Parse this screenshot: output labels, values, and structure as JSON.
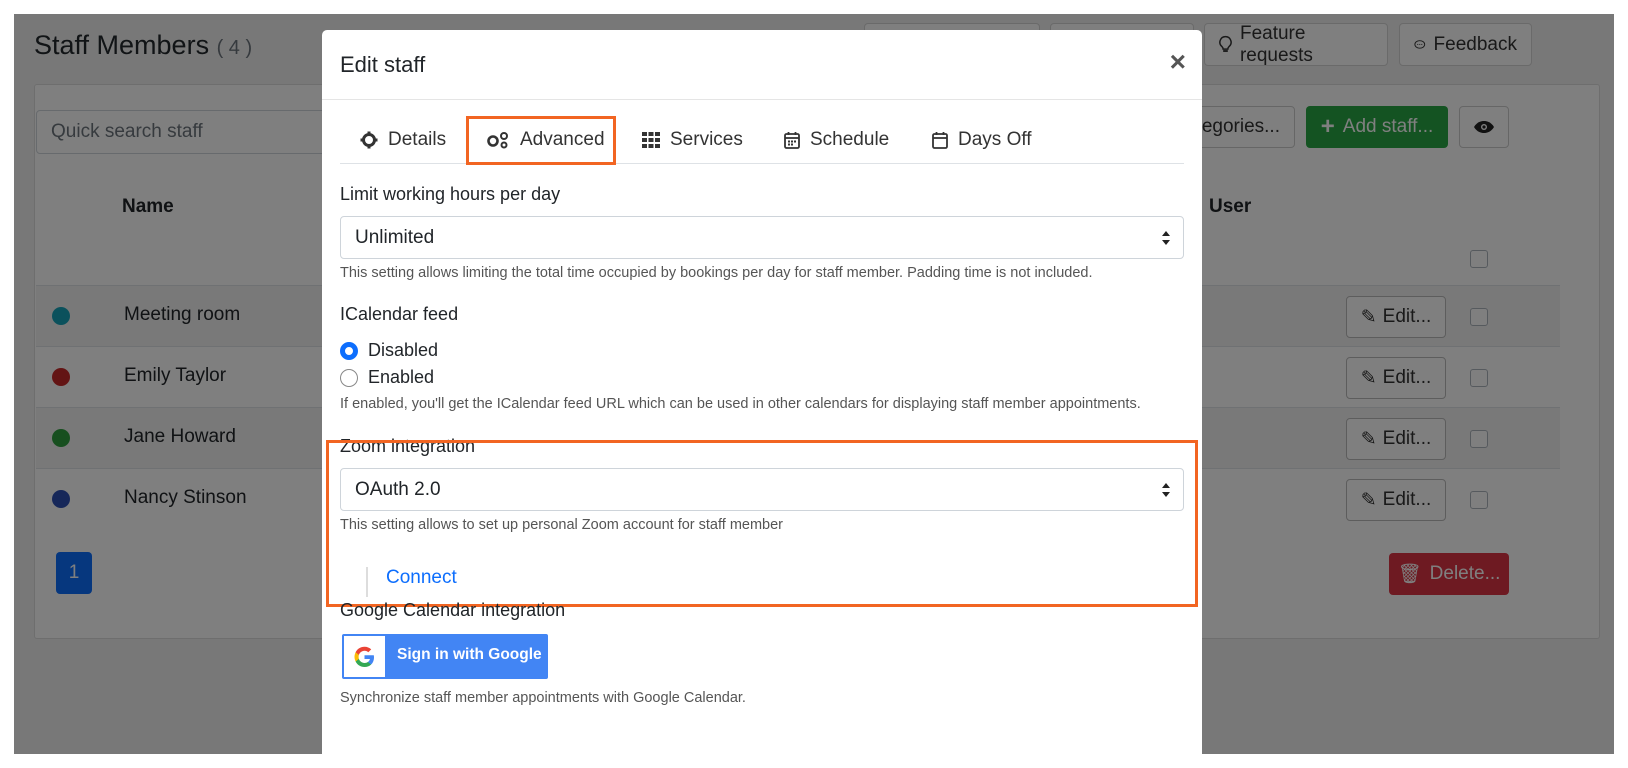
{
  "page": {
    "title": "Staff Members",
    "count": "( 4 )",
    "top_buttons": [
      "Feature requests",
      "Feedback"
    ],
    "categories_label": "tegories...",
    "add_staff_label": "Add staff...",
    "search_placeholder": "Quick search staff",
    "columns": {
      "name": "Name",
      "user": "User"
    },
    "rows": [
      {
        "name": "Meeting room",
        "color": "#17a2b8",
        "edit": "Edit..."
      },
      {
        "name": "Emily Taylor",
        "color": "#c62828",
        "edit": "Edit..."
      },
      {
        "name": "Jane Howard",
        "color": "#2e9e3e",
        "edit": "Edit..."
      },
      {
        "name": "Nancy Stinson",
        "color": "#2c4fb3",
        "edit": "Edit..."
      }
    ],
    "pagination": [
      "1"
    ],
    "delete_label": "Delete..."
  },
  "modal": {
    "title": "Edit staff",
    "close": "×",
    "tabs": [
      {
        "label": "Details",
        "icon": "gear-icon"
      },
      {
        "label": "Advanced",
        "icon": "gears-icon",
        "active": true
      },
      {
        "label": "Services",
        "icon": "grid-icon"
      },
      {
        "label": "Schedule",
        "icon": "calendar-week-icon"
      },
      {
        "label": "Days Off",
        "icon": "calendar-icon"
      }
    ],
    "limit": {
      "label": "Limit working hours per day",
      "value": "Unlimited",
      "help": "This setting allows limiting the total time occupied by bookings per day for staff member. Padding time is not included."
    },
    "icalendar": {
      "label": "ICalendar feed",
      "options": [
        {
          "label": "Disabled",
          "checked": true
        },
        {
          "label": "Enabled",
          "checked": false
        }
      ],
      "help": "If enabled, you'll get the ICalendar feed URL which can be used in other calendars for displaying staff member appointments."
    },
    "zoom": {
      "label": "Zoom integration",
      "value": "OAuth 2.0",
      "help": "This setting allows to set up personal Zoom account for staff member",
      "connect": "Connect"
    },
    "google": {
      "label": "Google Calendar integration",
      "button": "Sign in with Google",
      "help": "Synchronize staff member appointments with Google Calendar."
    }
  },
  "colors": {
    "accent": "#0d6efd",
    "highlight": "#f26522",
    "success": "#28a745",
    "danger": "#dc3545"
  }
}
